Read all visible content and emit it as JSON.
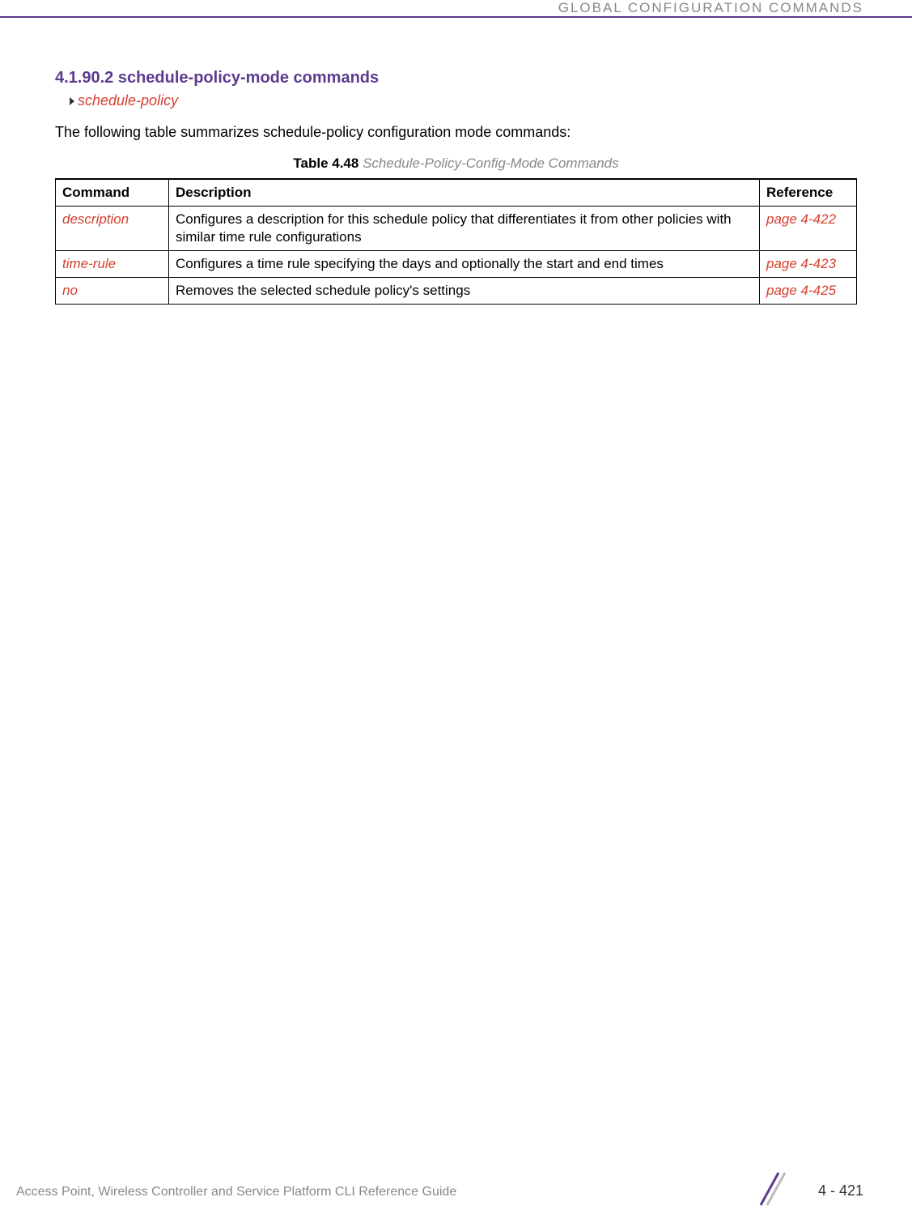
{
  "header": {
    "title": "GLOBAL CONFIGURATION COMMANDS"
  },
  "section": {
    "heading": "4.1.90.2 schedule-policy-mode commands",
    "breadcrumb": "schedule-policy",
    "intro": "The following table summarizes schedule-policy configuration mode commands:"
  },
  "table": {
    "caption_bold": "Table 4.48",
    "caption_italic": "Schedule-Policy-Config-Mode Commands",
    "headers": {
      "command": "Command",
      "description": "Description",
      "reference": "Reference"
    },
    "rows": [
      {
        "command": "description",
        "description": "Configures a description for this schedule policy that differentiates it from other policies with similar time rule configurations",
        "reference": "page 4-422"
      },
      {
        "command": "time-rule",
        "description": "Configures a time rule specifying the days and optionally the start and end times",
        "reference": "page 4-423"
      },
      {
        "command": "no",
        "description": "Removes the selected schedule policy's settings",
        "reference": "page 4-425"
      }
    ]
  },
  "footer": {
    "text": "Access Point, Wireless Controller and Service Platform CLI Reference Guide",
    "page": "4 - 421"
  }
}
